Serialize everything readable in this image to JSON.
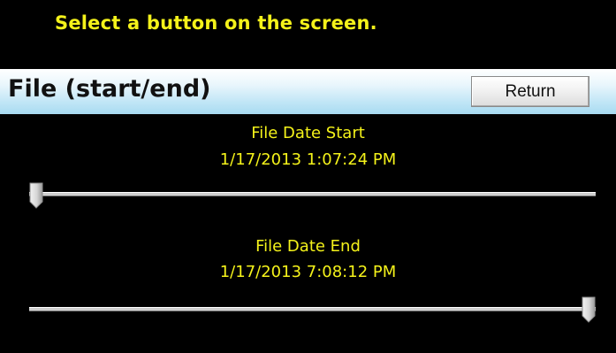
{
  "prompt": "Select a button on the screen.",
  "header": {
    "title": "File (start/end)",
    "return_label": "Return"
  },
  "start": {
    "label": "File Date Start",
    "value": "1/17/2013 1:07:24 PM",
    "slider_position": 0.0
  },
  "end": {
    "label": "File Date End",
    "value": "1/17/2013 7:08:12 PM",
    "slider_position": 1.0
  },
  "colors": {
    "background": "#000000",
    "text_accent": "#f4f21a",
    "header_gradient_bottom": "#a8dbf1"
  },
  "icons": {
    "slider_thumb": "pentagon-thumb-icon"
  }
}
